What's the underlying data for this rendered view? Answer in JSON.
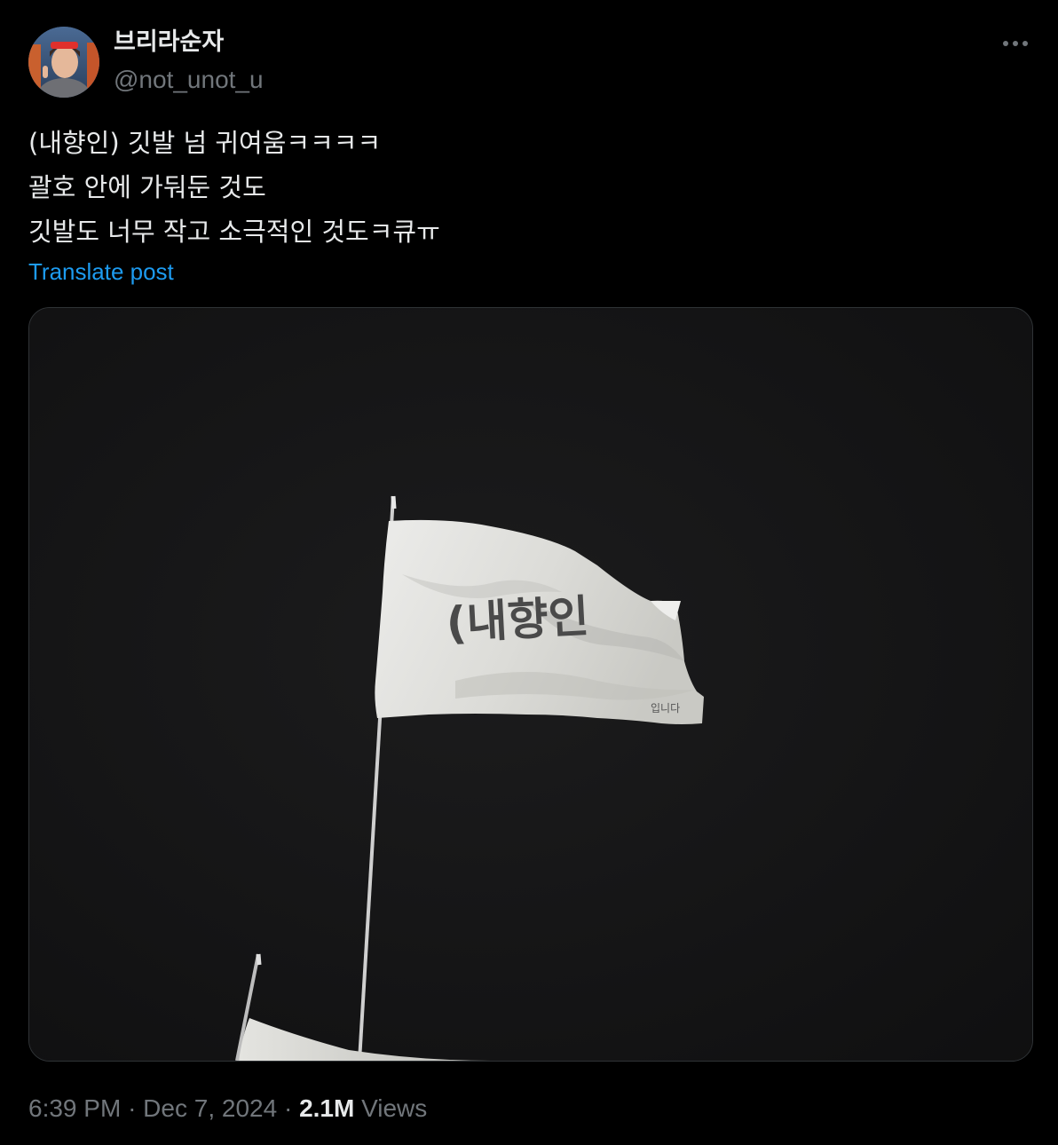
{
  "author": {
    "display_name": "브리라순자",
    "handle": "@not_unot_u"
  },
  "post": {
    "lines": [
      "(내향인) 깃발 넘 귀여움ㅋㅋㅋㅋ",
      "괄호 안에 가둬둔 것도",
      "깃발도 너무 작고 소극적인 것도ㅋ큐ㅠ"
    ],
    "translate_label": "Translate post"
  },
  "media": {
    "flag_text": "(내향인",
    "flag_small_text": "입니다"
  },
  "meta": {
    "time": "6:39 PM",
    "separator": "·",
    "date": "Dec 7, 2024",
    "views_count": "2.1M",
    "views_label": "Views"
  },
  "colors": {
    "background": "#000000",
    "text_primary": "#e7e9ea",
    "text_secondary": "#71767b",
    "link": "#1d9bf0"
  },
  "icons": {
    "more": "more-horizontal-icon"
  }
}
